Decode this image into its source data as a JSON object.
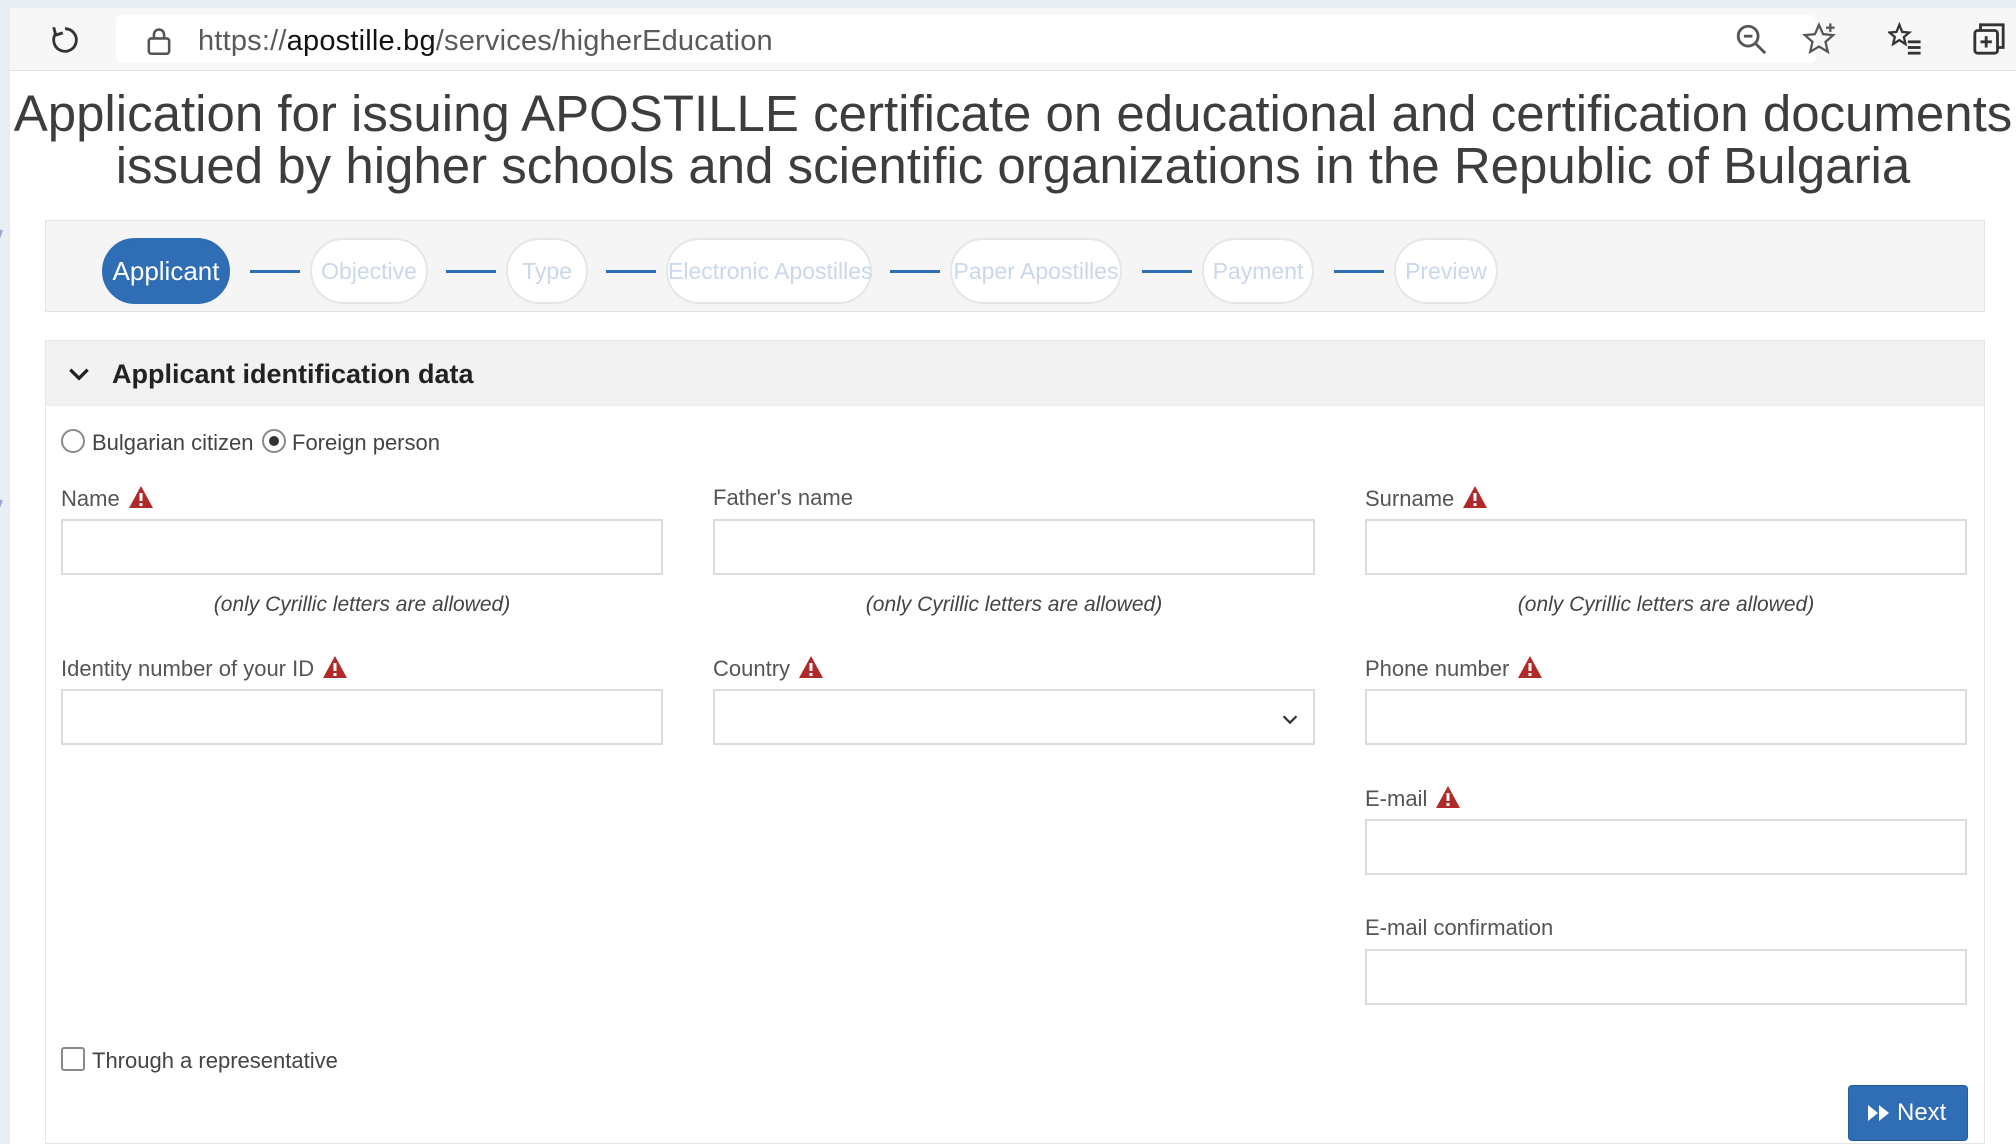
{
  "browser": {
    "url_prefix": "https://",
    "url_host": "apostille.bg",
    "url_path": "/services/higherEducation"
  },
  "page": {
    "title_line1": "Application for issuing APOSTILLE certificate on educational and certification documents",
    "title_line2": "issued by higher schools and scientific organizations in the Republic of Bulgaria"
  },
  "stepper": {
    "steps": [
      {
        "label": "Applicant",
        "active": true
      },
      {
        "label": "Objective",
        "active": false
      },
      {
        "label": "Type",
        "active": false
      },
      {
        "label": "Electronic Apostilles",
        "active": false
      },
      {
        "label": "Paper Apostilles",
        "active": false
      },
      {
        "label": "Payment",
        "active": false
      },
      {
        "label": "Preview",
        "active": false
      }
    ]
  },
  "section": {
    "title": "Applicant identification data",
    "person_type": {
      "options": [
        "Bulgarian citizen",
        "Foreign person"
      ],
      "selected": "Foreign person"
    },
    "fields": {
      "name": {
        "label": "Name",
        "value": "",
        "hint": "(only Cyrillic letters are allowed)",
        "required": true
      },
      "fathers_name": {
        "label": "Father's name",
        "value": "",
        "hint": "(only Cyrillic letters are allowed)",
        "required": false
      },
      "surname": {
        "label": "Surname",
        "value": "",
        "hint": "(only Cyrillic letters are allowed)",
        "required": true
      },
      "id_number": {
        "label": "Identity number of your ID",
        "value": "",
        "required": true
      },
      "country": {
        "label": "Country",
        "value": "",
        "required": true
      },
      "phone": {
        "label": "Phone number",
        "value": "",
        "required": true
      },
      "email": {
        "label": "E-mail",
        "value": "",
        "required": true
      },
      "email_confirmation": {
        "label": "E-mail confirmation",
        "value": "",
        "required": false
      }
    },
    "representative_label": "Through a representative",
    "representative_checked": false,
    "next_label": "Next"
  },
  "colors": {
    "accent": "#2f6db5",
    "warning": "#b02a2a",
    "inactive_step_text": "#cbd7ea"
  },
  "icons": {
    "reload": "reload-icon",
    "lock": "lock-icon",
    "zoom": "zoom-icon",
    "favorite": "star-icon",
    "favorites_bar": "favorites-list-icon",
    "collections": "collections-icon",
    "warning": "warning-icon",
    "chevron": "chevron-down-icon",
    "next": "fast-forward-icon"
  }
}
